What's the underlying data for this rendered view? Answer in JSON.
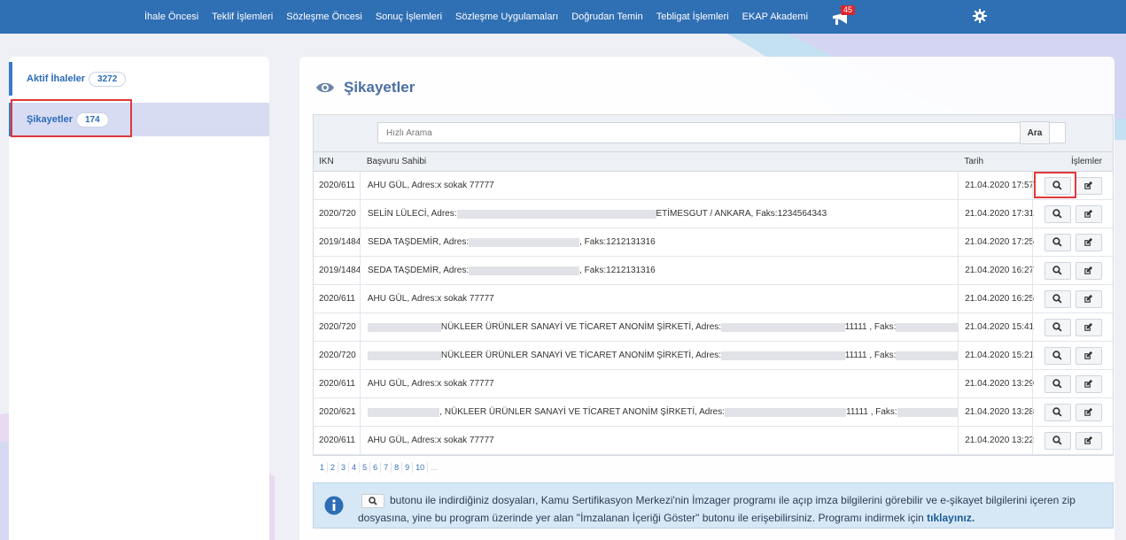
{
  "nav": {
    "items": [
      "İhale Öncesi",
      "Teklif İşlemleri",
      "Sözleşme Öncesi",
      "Sonuç İşlemleri",
      "Sözleşme Uygulamaları",
      "Doğrudan Temin",
      "Tebligat İşlemleri",
      "EKAP Akademi"
    ],
    "notif_count": "45",
    "megaphone_icon": "megaphone-icon",
    "settings_icon": "gear-icon"
  },
  "sidebar": {
    "items": [
      {
        "label": "Aktif İhaleler",
        "count": "3272"
      },
      {
        "label": "Şikayetler",
        "count": "174"
      }
    ]
  },
  "main": {
    "title": "Şikayetler",
    "title_icon": "eye-icon",
    "search": {
      "placeholder": "Hızlı Arama",
      "button": "Ara"
    },
    "columns": {
      "ikn": "IKN",
      "applicant": "Başvuru Sahibi",
      "date": "Tarih",
      "actions": "İşlemler"
    },
    "rows": [
      {
        "ikn": "2020/611",
        "parts": [
          "AHU GÜL, Adres:x sokak 77777"
        ],
        "date": "21.04.2020 17:57"
      },
      {
        "ikn": "2020/720",
        "parts": [
          "SELİN LÜLECİ, Adres:",
          "ETİMESGUT / ANKARA, Faks:1234564343"
        ],
        "date": "21.04.2020 17:31"
      },
      {
        "ikn": "2019/1484",
        "parts": [
          "SEDA TAŞDEMİR, Adres:",
          ", Faks:1212131316"
        ],
        "date": "21.04.2020 17:25"
      },
      {
        "ikn": "2019/1484",
        "parts": [
          "SEDA TAŞDEMİR, Adres:",
          ", Faks:1212131316"
        ],
        "date": "21.04.2020 16:27"
      },
      {
        "ikn": "2020/611",
        "parts": [
          "AHU GÜL, Adres:x sokak 77777"
        ],
        "date": "21.04.2020 16:25"
      },
      {
        "ikn": "2020/720",
        "parts": [
          "",
          "NÜKLEER ÜRÜNLER SANAYİ VE TİCARET ANONİM ŞİRKETİ, Adres:",
          "11111 , Faks:"
        ],
        "date": "21.04.2020 15:41"
      },
      {
        "ikn": "2020/720",
        "parts": [
          "",
          "NÜKLEER ÜRÜNLER SANAYİ VE TİCARET ANONİM ŞİRKETİ, Adres:",
          "11111 , Faks:"
        ],
        "date": "21.04.2020 15:21"
      },
      {
        "ikn": "2020/611",
        "parts": [
          "AHU GÜL, Adres:x sokak 77777"
        ],
        "date": "21.04.2020 13:29"
      },
      {
        "ikn": "2020/621",
        "parts": [
          "",
          ", NÜKLEER ÜRÜNLER SANAYİ VE TİCARET ANONİM ŞİRKETİ, Adres:",
          "11111 , Faks:"
        ],
        "date": "21.04.2020 13:28"
      },
      {
        "ikn": "2020/611",
        "parts": [
          "AHU GÜL, Adres:x sokak 77777"
        ],
        "date": "21.04.2020 13:22"
      }
    ],
    "action_icons": [
      "search-icon",
      "edit-icon"
    ],
    "pager": [
      "1",
      "2",
      "3",
      "4",
      "5",
      "6",
      "7",
      "8",
      "9",
      "10",
      "..."
    ],
    "info": {
      "line1": "butonu ile indirdiğiniz dosyaları, Kamu Sertifikasyon Merkezi'nin İmzager programı ile açıp imza bilgilerini görebilir ve e-şikayet bilgilerini içeren zip",
      "line2": "dosyasına, yine bu program üzerinde yer alan \"İmzalanan İçeriği Göster\" butonu ile erişebilirsiniz. Programı indirmek için ",
      "link": "tıklayınız."
    }
  },
  "colors": {
    "nav": "#2f6fb4",
    "accent": "#3a7bc8",
    "highlight": "#e0393b",
    "info_bg": "#d6e8f5"
  }
}
